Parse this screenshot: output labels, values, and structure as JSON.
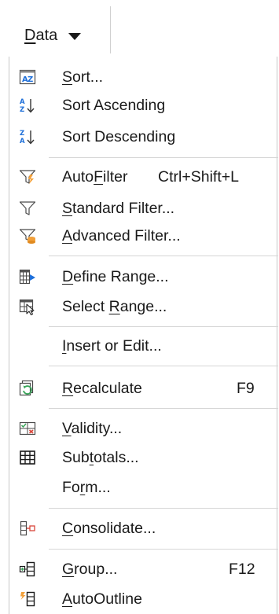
{
  "menu": {
    "title_pre": "",
    "title_u": "D",
    "title_post": "ata"
  },
  "items": {
    "sort": {
      "pre": "",
      "u": "S",
      "post": "ort..."
    },
    "sort_asc": {
      "pre": "Sort Ascending",
      "u": "",
      "post": ""
    },
    "sort_desc": {
      "pre": "Sort Descending",
      "u": "",
      "post": ""
    },
    "autofilter": {
      "pre": "Auto",
      "u": "F",
      "post": "ilter",
      "shortcut": "Ctrl+Shift+L"
    },
    "standard_filter": {
      "pre": "",
      "u": "S",
      "post": "tandard Filter..."
    },
    "advanced_filter": {
      "pre": "",
      "u": "A",
      "post": "dvanced Filter..."
    },
    "define_range": {
      "pre": "",
      "u": "D",
      "post": "efine Range..."
    },
    "select_range": {
      "pre": "Select ",
      "u": "R",
      "post": "ange..."
    },
    "insert_edit": {
      "pre": "",
      "u": "I",
      "post": "nsert or Edit..."
    },
    "recalculate": {
      "pre": "",
      "u": "R",
      "post": "ecalculate",
      "shortcut": "F9"
    },
    "validity": {
      "pre": "",
      "u": "V",
      "post": "alidity..."
    },
    "subtotals": {
      "pre": "Sub",
      "u": "t",
      "post": "otals..."
    },
    "form": {
      "pre": "Fo",
      "u": "r",
      "post": "m..."
    },
    "consolidate": {
      "pre": "",
      "u": "C",
      "post": "onsolidate..."
    },
    "group": {
      "pre": "",
      "u": "G",
      "post": "roup...",
      "shortcut": "F12"
    },
    "autooutline": {
      "pre": "",
      "u": "A",
      "post": "utoOutline"
    }
  },
  "icons": {
    "sort": "sort-dialog-icon",
    "sort_asc": "sort-ascending-icon",
    "sort_desc": "sort-descending-icon",
    "autofilter": "autofilter-funnel-icon",
    "standard_filter": "funnel-icon",
    "advanced_filter": "advanced-filter-icon",
    "define_range": "define-range-icon",
    "select_range": "select-range-icon",
    "recalculate": "recalculate-icon",
    "validity": "validity-icon",
    "subtotals": "subtotals-grid-icon",
    "consolidate": "consolidate-icon",
    "group": "group-icon",
    "autooutline": "autooutline-icon"
  },
  "colors": {
    "accent_blue": "#1e6fd9",
    "accent_orange": "#f2a03a",
    "accent_red": "#d9453a",
    "accent_green": "#3aa55a",
    "separator": "#d6d6d6"
  }
}
